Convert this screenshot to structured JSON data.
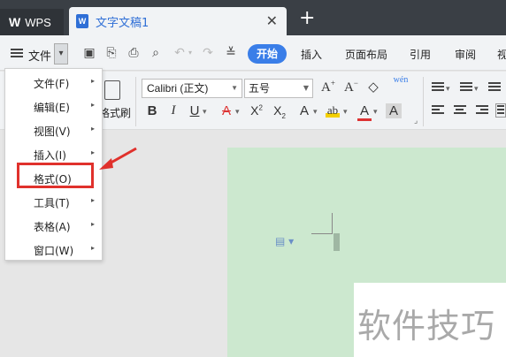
{
  "title_bar": {
    "app_tab": "WPS",
    "doc_tab": "文字文稿1",
    "doc_icon": "W",
    "close_icon": "close-icon",
    "new_tab_icon": "plus-icon"
  },
  "menubar": {
    "file_label": "文件",
    "ribbon_tabs": [
      "开始",
      "插入",
      "页面布局",
      "引用",
      "审阅",
      "视"
    ],
    "active_tab_color": "#3a7ee8"
  },
  "ribbon": {
    "format_painter": "格式刷",
    "font_name": "Calibri (正文)",
    "font_size": "五号",
    "phonetic_guide": "wén"
  },
  "file_menu": {
    "items": [
      "文件(F)",
      "编辑(E)",
      "视图(V)",
      "插入(I)",
      "格式(O)",
      "工具(T)",
      "表格(A)",
      "窗口(W)"
    ],
    "highlighted": "格式(O)",
    "highlight_color": "#e0312c"
  },
  "document": {
    "page_color": "#cce8cf",
    "watermark": "软件技巧"
  }
}
